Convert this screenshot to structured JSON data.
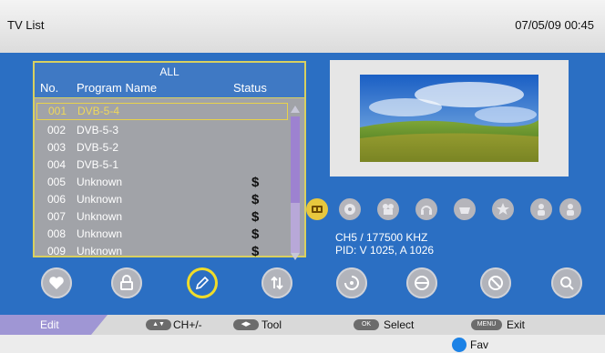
{
  "header": {
    "title": "TV List",
    "datetime": "07/05/09 00:45"
  },
  "list": {
    "group": "ALL",
    "columns": {
      "no": "No.",
      "name": "Program Name",
      "status": "Status"
    },
    "rows": [
      {
        "no": "001",
        "name": "DVB-5-4",
        "status": "",
        "selected": true
      },
      {
        "no": "002",
        "name": "DVB-5-3",
        "status": ""
      },
      {
        "no": "003",
        "name": "DVB-5-2",
        "status": ""
      },
      {
        "no": "004",
        "name": "DVB-5-1",
        "status": ""
      },
      {
        "no": "005",
        "name": "Unknown",
        "status": "$"
      },
      {
        "no": "006",
        "name": "Unknown",
        "status": "$"
      },
      {
        "no": "007",
        "name": "Unknown",
        "status": "$"
      },
      {
        "no": "008",
        "name": "Unknown",
        "status": "$"
      },
      {
        "no": "009",
        "name": "Unknown",
        "status": "$"
      }
    ],
    "scroll_fraction": 0.63
  },
  "preview": {
    "icon": "landscape-thumbnail"
  },
  "filter_icons": [
    "tv-icon",
    "soccer-icon",
    "movie-icon",
    "music-icon",
    "bowl-icon",
    "star-icon",
    "person-icon",
    "person-icon"
  ],
  "channel_info": {
    "frequency": "CH5 / 177500  KHZ",
    "pid": "PID: V 1025, A 1026"
  },
  "actions": [
    "heart-icon",
    "lock-icon",
    "pencil-icon",
    "sort-icon",
    "move-icon",
    "skip-icon",
    "delete-icon",
    "search-icon"
  ],
  "help": {
    "mode": "Edit",
    "ch": {
      "key": "▲▼",
      "label": "CH+/-"
    },
    "tool": {
      "key": "◀▶",
      "label": "Tool"
    },
    "select": {
      "key": "OK",
      "label": "Select"
    },
    "exit": {
      "key": "MENU",
      "label": "Exit"
    }
  },
  "fav": {
    "label": "Fav",
    "color": "#1c82e6"
  },
  "colors": {
    "panel": "#2b6fc3",
    "highlight": "#f0d85a",
    "edit_tab": "#9f96d4"
  }
}
